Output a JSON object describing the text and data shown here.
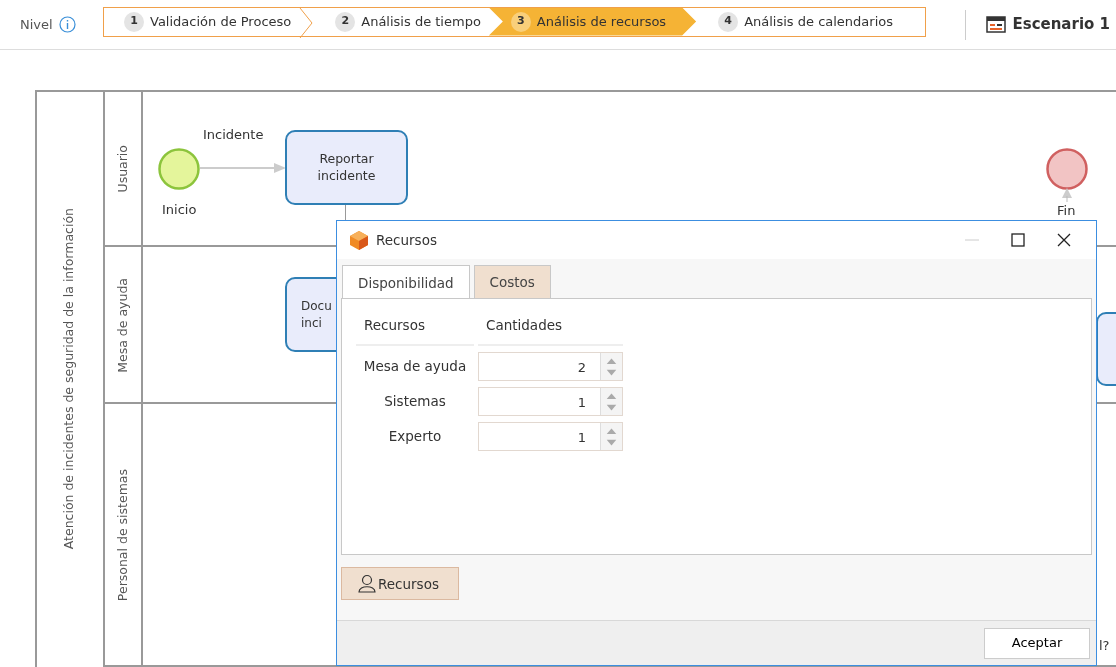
{
  "header": {
    "level_label": "Nivel",
    "steps": [
      {
        "number": "1",
        "label": "Validación de Proceso",
        "selected": false
      },
      {
        "number": "2",
        "label": "Análisis de tiempo",
        "selected": false
      },
      {
        "number": "3",
        "label": "Análisis de recursos",
        "selected": true
      },
      {
        "number": "4",
        "label": "Análisis de calendarios",
        "selected": false
      }
    ],
    "scenario": "Escenario 1"
  },
  "diagram": {
    "pool": "Atención de incidentes de seguridad de la información",
    "lanes": [
      {
        "name": "Usuario"
      },
      {
        "name": "Mesa de ayuda"
      },
      {
        "name": "Personal de sistemas"
      }
    ],
    "events": [
      {
        "kind": "start",
        "label": "Inicio"
      },
      {
        "kind": "end",
        "label": "Fin"
      }
    ],
    "flow_label": "Incidente",
    "tasks": [
      {
        "lines": [
          "Reportar",
          "incidente"
        ]
      },
      {
        "lines": [
          "Docu",
          "inci"
        ]
      }
    ],
    "partial_text": "l?"
  },
  "dialog": {
    "title": "Recursos",
    "tabs": [
      {
        "label": "Disponibilidad",
        "selected": true
      },
      {
        "label": "Costos",
        "selected": false
      }
    ],
    "columns": [
      "Recursos",
      "Cantidades"
    ],
    "rows": [
      {
        "name": "Mesa de ayuda",
        "quantity": "2"
      },
      {
        "name": "Sistemas",
        "quantity": "1"
      },
      {
        "name": "Experto",
        "quantity": "1"
      }
    ],
    "resources_button": "Recursos",
    "accept_button": "Aceptar"
  }
}
